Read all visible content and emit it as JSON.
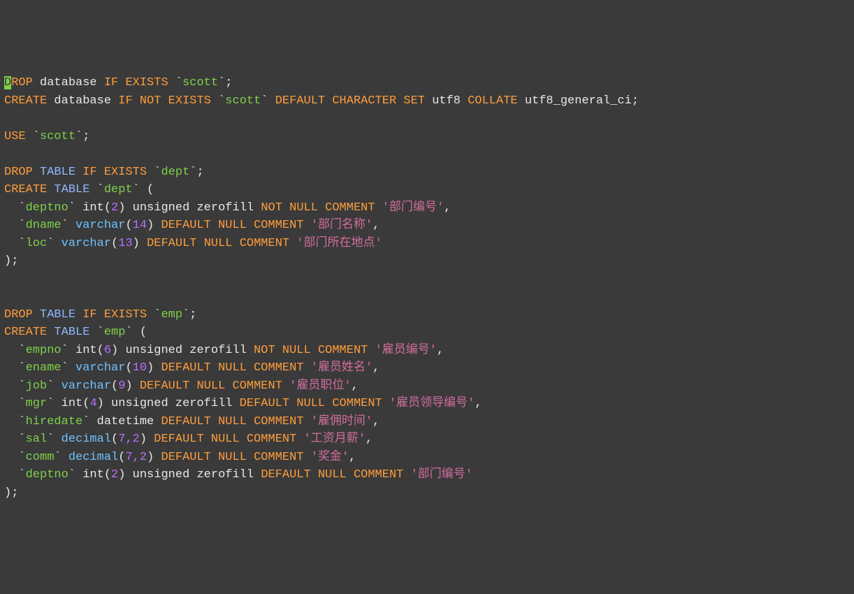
{
  "db": "scott",
  "charset": "utf8",
  "collate": "utf8_general_ci",
  "dept": {
    "name": "dept",
    "cols": {
      "deptno": {
        "name": "deptno",
        "len": "2",
        "comment": "部门编号"
      },
      "dname": {
        "name": "dname",
        "len": "14",
        "comment": "部门名称"
      },
      "loc": {
        "name": "loc",
        "len": "13",
        "comment": "部门所在地点"
      }
    }
  },
  "emp": {
    "name": "emp",
    "cols": {
      "empno": {
        "name": "empno",
        "len": "6",
        "comment": "雇员编号"
      },
      "ename": {
        "name": "ename",
        "len": "10",
        "comment": "雇员姓名"
      },
      "job": {
        "name": "job",
        "len": "9",
        "comment": "雇员职位"
      },
      "mgr": {
        "name": "mgr",
        "len": "4",
        "comment": "雇员领导编号"
      },
      "hiredate": {
        "name": "hiredate",
        "comment": "雇佣时间"
      },
      "sal": {
        "name": "sal",
        "len": "7,2",
        "comment": "工资月薪"
      },
      "comm": {
        "name": "comm",
        "len": "7,2",
        "comment": "奖金"
      },
      "deptno": {
        "name": "deptno",
        "len": "2",
        "comment": "部门编号"
      }
    }
  },
  "kw": {
    "DROP": "DROP",
    "CREATE": "CREATE",
    "database": "database",
    "IF": "IF",
    "EXISTS": "EXISTS",
    "NOT": "NOT",
    "DEFAULT": "DEFAULT",
    "CHARACTER": "CHARACTER",
    "SET": "SET",
    "COLLATE": "COLLATE",
    "USE": "USE",
    "TABLE": "TABLE",
    "int": "int",
    "unsigned": "unsigned",
    "zerofill": "zerofill",
    "NULL": "NULL",
    "COMMENT": "COMMENT",
    "varchar": "varchar",
    "datetime": "datetime",
    "decimal": "decimal"
  }
}
